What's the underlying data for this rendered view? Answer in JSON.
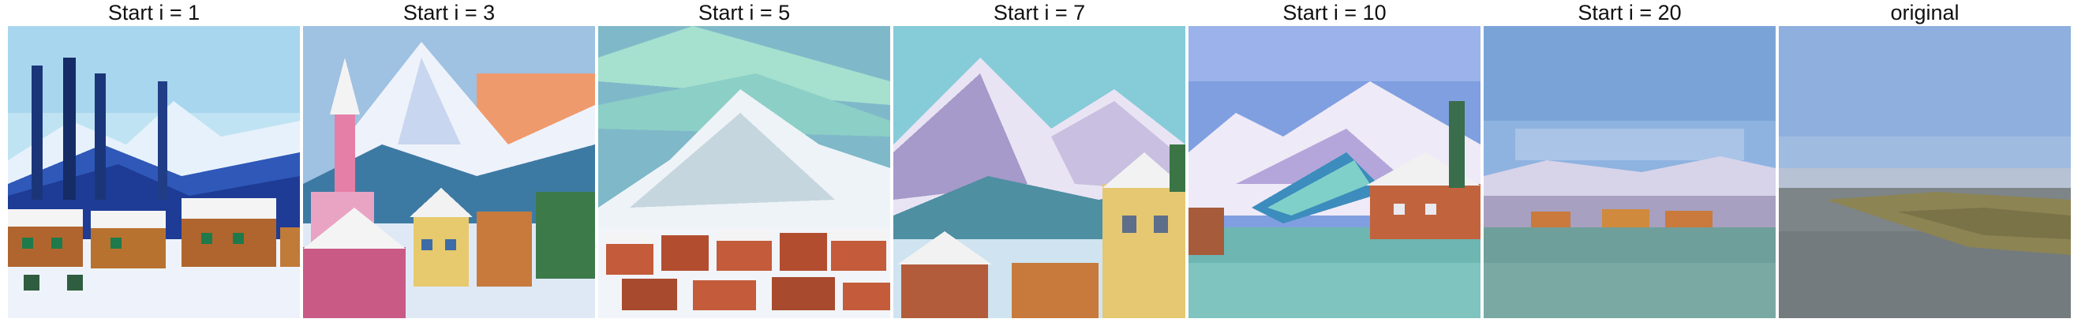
{
  "panels": [
    {
      "title": "Start i = 1",
      "image_description": "pixelated snowy village scene with tall dark pine trees and red-roofed chalets in snow"
    },
    {
      "title": "Start i = 3",
      "image_description": "pixelated snowy mountain with church spire and colorful village houses, orange sky"
    },
    {
      "title": "Start i = 5",
      "image_description": "pixelated snowy mountain with aurora sky above a red-roofed village"
    },
    {
      "title": "Start i = 7",
      "image_description": "pixelated purple-white mountains with snowy village houses in foreground"
    },
    {
      "title": "Start i = 10",
      "image_description": "pixelated mountains with a river and snowy village houses on the right"
    },
    {
      "title": "Start i = 20",
      "image_description": "pixelated hazy mountain range with lakeside town and teal water"
    },
    {
      "title": "original",
      "image_description": "low-resolution photo of a grey lake with grassy marsh and distant hills"
    }
  ]
}
